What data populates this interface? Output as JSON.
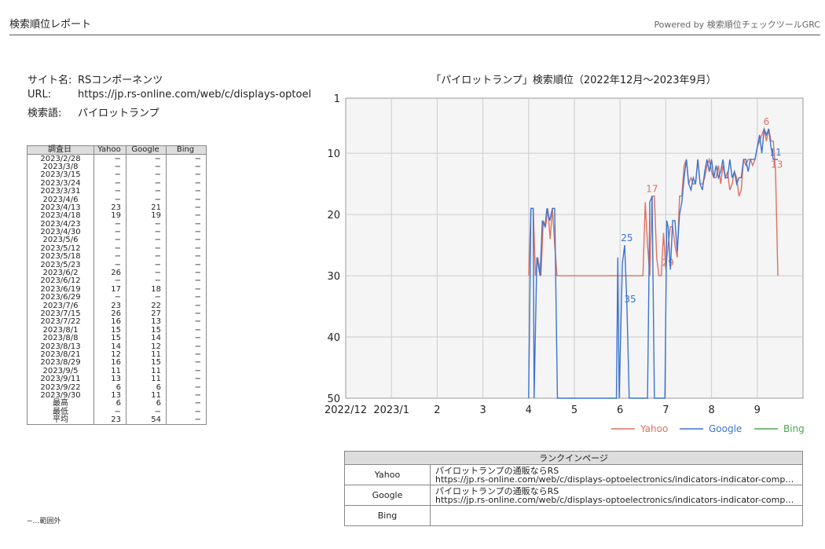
{
  "header": {
    "title": "検索順位レポート",
    "powered": "Powered by 検索順位チェックツールGRC"
  },
  "site": {
    "name_label": "サイト名:",
    "name": "RSコンポーネンツ",
    "url_label": "URL:",
    "url": "https://jp.rs-online.com/web/c/displays-optoelectronics/indicators-indicator-components",
    "keyword_label": "検索語:",
    "keyword": "パイロットランプ"
  },
  "table": {
    "headers": [
      "調査日",
      "Yahoo",
      "Google",
      "Bing"
    ],
    "rows": [
      [
        "2023/2/28",
        "−",
        "−",
        "−"
      ],
      [
        "2023/3/8",
        "−",
        "−",
        "−"
      ],
      [
        "2023/3/15",
        "−",
        "−",
        "−"
      ],
      [
        "2023/3/24",
        "−",
        "−",
        "−"
      ],
      [
        "2023/3/31",
        "−",
        "−",
        "−"
      ],
      [
        "2023/4/6",
        "−",
        "−",
        "−"
      ],
      [
        "2023/4/13",
        "23",
        "21",
        "−"
      ],
      [
        "2023/4/18",
        "19",
        "19",
        "−"
      ],
      [
        "2023/4/23",
        "−",
        "−",
        "−"
      ],
      [
        "2023/4/30",
        "−",
        "−",
        "−"
      ],
      [
        "2023/5/6",
        "−",
        "−",
        "−"
      ],
      [
        "2023/5/12",
        "−",
        "−",
        "−"
      ],
      [
        "2023/5/18",
        "−",
        "−",
        "−"
      ],
      [
        "2023/5/23",
        "−",
        "−",
        "−"
      ],
      [
        "2023/6/2",
        "26",
        "−",
        "−"
      ],
      [
        "2023/6/12",
        "−",
        "−",
        "−"
      ],
      [
        "2023/6/19",
        "17",
        "18",
        "−"
      ],
      [
        "2023/6/29",
        "−",
        "−",
        "−"
      ],
      [
        "2023/7/6",
        "23",
        "22",
        "−"
      ],
      [
        "2023/7/15",
        "26",
        "27",
        "−"
      ],
      [
        "2023/7/22",
        "16",
        "13",
        "−"
      ],
      [
        "2023/8/1",
        "15",
        "15",
        "−"
      ],
      [
        "2023/8/8",
        "15",
        "14",
        "−"
      ],
      [
        "2023/8/13",
        "14",
        "12",
        "−"
      ],
      [
        "2023/8/21",
        "12",
        "11",
        "−"
      ],
      [
        "2023/8/29",
        "16",
        "15",
        "−"
      ],
      [
        "2023/9/5",
        "11",
        "11",
        "−"
      ],
      [
        "2023/9/11",
        "13",
        "11",
        "−"
      ],
      [
        "2023/9/22",
        "6",
        "6",
        "−"
      ],
      [
        "2023/9/30",
        "13",
        "11",
        "−"
      ],
      [
        "最高",
        "6",
        "6",
        "−"
      ],
      [
        "最低",
        "−",
        "−",
        "−"
      ],
      [
        "平均",
        "23",
        "54",
        "−"
      ]
    ]
  },
  "footnote": "−…範囲外",
  "chart_data": {
    "type": "line",
    "title": "「パイロットランプ」検索順位（2022年12月〜2023年9月）",
    "y_inverted": true,
    "ylim": [
      1,
      50
    ],
    "yticks": [
      1,
      10,
      20,
      30,
      40,
      50
    ],
    "xlim": [
      0,
      10
    ],
    "xtick_positions": [
      0,
      1,
      2,
      3,
      4,
      5,
      6,
      7,
      8,
      9
    ],
    "xtick_labels": [
      "2022/12",
      "2023/1",
      "2",
      "3",
      "4",
      "5",
      "6",
      "7",
      "8",
      "9"
    ],
    "grid": true,
    "legend_position": "bottom-right",
    "series": [
      {
        "name": "Yahoo",
        "color": "#e07060",
        "points": [
          [
            4.0,
            30
          ],
          [
            4.05,
            19
          ],
          [
            4.1,
            19
          ],
          [
            4.15,
            30
          ],
          [
            4.2,
            27
          ],
          [
            4.27,
            30
          ],
          [
            4.32,
            21
          ],
          [
            4.37,
            22
          ],
          [
            4.42,
            19
          ],
          [
            4.47,
            24
          ],
          [
            4.52,
            19
          ],
          [
            4.57,
            25
          ],
          [
            4.62,
            30
          ],
          [
            6.5,
            30
          ],
          [
            6.55,
            18
          ],
          [
            6.6,
            25
          ],
          [
            6.65,
            30
          ],
          [
            6.7,
            17
          ],
          [
            6.75,
            17
          ],
          [
            6.8,
            27
          ],
          [
            6.85,
            30
          ],
          [
            6.9,
            30
          ],
          [
            6.95,
            23
          ],
          [
            7.0,
            29
          ],
          [
            7.05,
            25
          ],
          [
            7.1,
            22
          ],
          [
            7.15,
            22
          ],
          [
            7.2,
            25
          ],
          [
            7.25,
            27
          ],
          [
            7.3,
            17
          ],
          [
            7.35,
            17
          ],
          [
            7.4,
            12
          ],
          [
            7.45,
            11
          ],
          [
            7.5,
            15
          ],
          [
            7.55,
            14
          ],
          [
            7.6,
            15
          ],
          [
            7.65,
            15
          ],
          [
            7.7,
            11
          ],
          [
            7.75,
            15
          ],
          [
            7.8,
            15
          ],
          [
            7.85,
            14
          ],
          [
            7.9,
            12
          ],
          [
            7.95,
            11
          ],
          [
            8.0,
            13
          ],
          [
            8.05,
            14
          ],
          [
            8.1,
            14
          ],
          [
            8.15,
            12
          ],
          [
            8.2,
            15
          ],
          [
            8.25,
            12
          ],
          [
            8.3,
            14
          ],
          [
            8.35,
            13
          ],
          [
            8.4,
            16
          ],
          [
            8.45,
            15
          ],
          [
            8.5,
            13
          ],
          [
            8.55,
            14
          ],
          [
            8.6,
            17
          ],
          [
            8.65,
            16
          ],
          [
            8.7,
            11
          ],
          [
            8.75,
            12
          ],
          [
            8.8,
            11
          ],
          [
            8.85,
            11
          ],
          [
            8.9,
            12
          ],
          [
            8.95,
            11
          ],
          [
            9.0,
            9
          ],
          [
            9.05,
            8
          ],
          [
            9.1,
            7
          ],
          [
            9.15,
            6
          ],
          [
            9.2,
            8
          ],
          [
            9.25,
            6
          ],
          [
            9.3,
            8
          ],
          [
            9.35,
            8
          ],
          [
            9.4,
            13
          ],
          [
            9.45,
            30
          ]
        ],
        "labels": [
          [
            6.7,
            17,
            "17"
          ],
          [
            7.05,
            29,
            "29"
          ],
          [
            9.2,
            6,
            "6"
          ],
          [
            9.43,
            13,
            "13"
          ]
        ]
      },
      {
        "name": "Google",
        "color": "#3b74d0",
        "points": [
          [
            4.0,
            50
          ],
          [
            4.05,
            19
          ],
          [
            4.1,
            19
          ],
          [
            4.12,
            50
          ],
          [
            4.18,
            27
          ],
          [
            4.25,
            30
          ],
          [
            4.3,
            21
          ],
          [
            4.36,
            22
          ],
          [
            4.4,
            19
          ],
          [
            4.46,
            21
          ],
          [
            4.52,
            19
          ],
          [
            4.57,
            19
          ],
          [
            4.63,
            50
          ],
          [
            5.92,
            50
          ],
          [
            5.95,
            27
          ],
          [
            5.98,
            50
          ],
          [
            6.05,
            28
          ],
          [
            6.1,
            25
          ],
          [
            6.15,
            35
          ],
          [
            6.2,
            50
          ],
          [
            6.6,
            50
          ],
          [
            6.65,
            18
          ],
          [
            6.7,
            17
          ],
          [
            6.75,
            50
          ],
          [
            6.98,
            50
          ],
          [
            7.02,
            21
          ],
          [
            7.05,
            22
          ],
          [
            7.1,
            29
          ],
          [
            7.15,
            21
          ],
          [
            7.2,
            21
          ],
          [
            7.25,
            26
          ],
          [
            7.3,
            20
          ],
          [
            7.35,
            18
          ],
          [
            7.4,
            14
          ],
          [
            7.45,
            11
          ],
          [
            7.5,
            15
          ],
          [
            7.55,
            16
          ],
          [
            7.6,
            14
          ],
          [
            7.65,
            15
          ],
          [
            7.7,
            11
          ],
          [
            7.75,
            15
          ],
          [
            7.8,
            16
          ],
          [
            7.85,
            13
          ],
          [
            7.9,
            11
          ],
          [
            7.95,
            13
          ],
          [
            8.0,
            11
          ],
          [
            8.05,
            14
          ],
          [
            8.1,
            12
          ],
          [
            8.15,
            14
          ],
          [
            8.2,
            13
          ],
          [
            8.25,
            11
          ],
          [
            8.3,
            14
          ],
          [
            8.35,
            14
          ],
          [
            8.4,
            11
          ],
          [
            8.45,
            14
          ],
          [
            8.5,
            13
          ],
          [
            8.55,
            15
          ],
          [
            8.6,
            14
          ],
          [
            8.65,
            14
          ],
          [
            8.7,
            11
          ],
          [
            8.75,
            11
          ],
          [
            8.8,
            13
          ],
          [
            8.85,
            11
          ],
          [
            8.9,
            11
          ],
          [
            8.95,
            11
          ],
          [
            9.0,
            9
          ],
          [
            9.05,
            7
          ],
          [
            9.1,
            10
          ],
          [
            9.15,
            6
          ],
          [
            9.2,
            7
          ],
          [
            9.25,
            6
          ],
          [
            9.3,
            9
          ],
          [
            9.35,
            11
          ],
          [
            9.4,
            11
          ],
          [
            9.45,
            11
          ]
        ],
        "labels": [
          [
            6.15,
            25,
            "25"
          ],
          [
            6.22,
            35,
            "35"
          ],
          [
            9.4,
            11,
            "11"
          ]
        ]
      },
      {
        "name": "Bing",
        "color": "#4aa84a",
        "points": [],
        "labels": []
      }
    ]
  },
  "rank_table": {
    "title": "ランクインページ",
    "rows": [
      {
        "engine": "Yahoo",
        "page_title": "パイロットランプの通販ならRS",
        "url": "https://jp.rs-online.com/web/c/displays-optoelectronics/indicators-indicator-components"
      },
      {
        "engine": "Google",
        "page_title": "パイロットランプの通販ならRS",
        "url": "https://jp.rs-online.com/web/c/displays-optoelectronics/indicators-indicator-components"
      },
      {
        "engine": "Bing",
        "page_title": "",
        "url": ""
      }
    ]
  }
}
